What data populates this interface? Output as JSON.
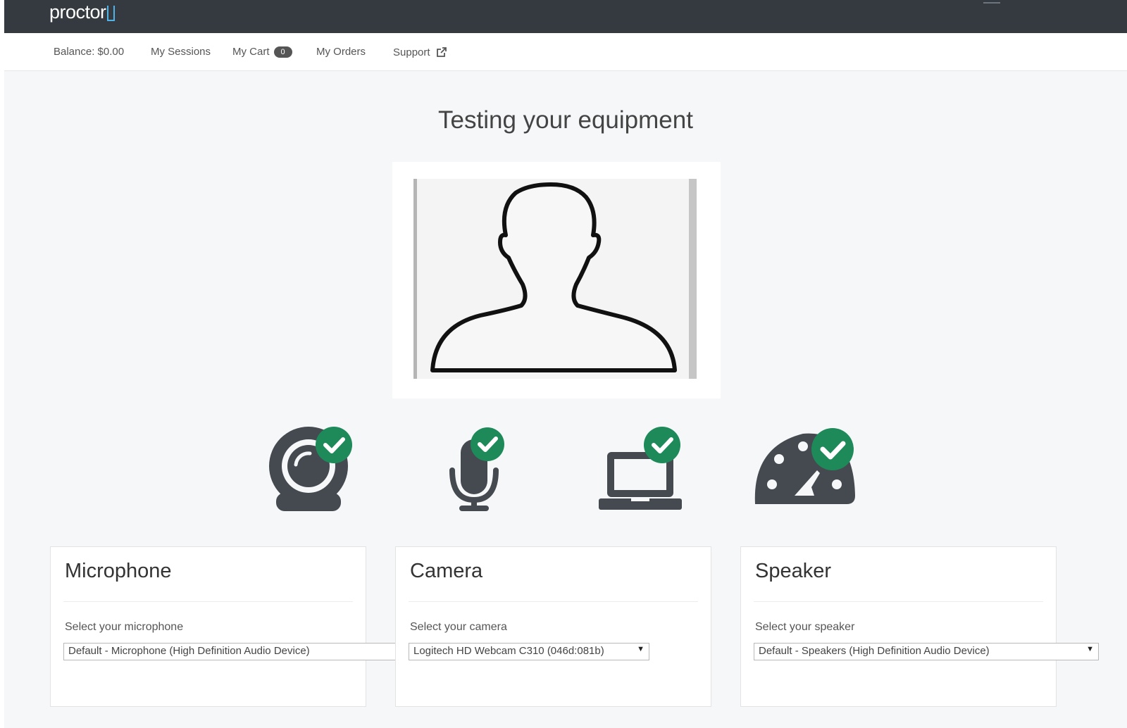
{
  "brand": {
    "name": "proctor",
    "accent": "#4fb3e8"
  },
  "nav": {
    "balance": "Balance: $0.00",
    "sessions": "My Sessions",
    "cart": "My Cart",
    "cart_count": "0",
    "orders": "My Orders",
    "support": "Support"
  },
  "page": {
    "title": "Testing your equipment"
  },
  "checks": [
    {
      "icon": "webcam-icon",
      "status": "passed"
    },
    {
      "icon": "microphone-icon",
      "status": "passed"
    },
    {
      "icon": "laptop-icon",
      "status": "passed"
    },
    {
      "icon": "speedometer-icon",
      "status": "passed"
    }
  ],
  "colors": {
    "topbar": "#343a40",
    "check": "#1e8a5a",
    "icon": "#454a50"
  },
  "microphone": {
    "title": "Microphone",
    "label": "Select your microphone",
    "selected": "Default - Microphone (High Definition Audio Device)"
  },
  "camera": {
    "title": "Camera",
    "label": "Select your camera",
    "selected": "Logitech HD Webcam C310 (046d:081b)"
  },
  "speaker": {
    "title": "Speaker",
    "label": "Select your speaker",
    "selected": "Default - Speakers (High Definition Audio Device)"
  }
}
